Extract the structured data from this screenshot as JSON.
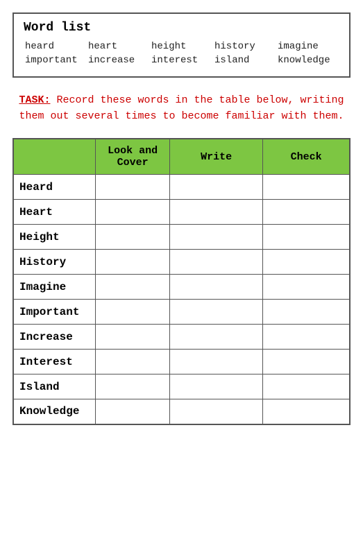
{
  "wordList": {
    "title": "Word list",
    "words": [
      [
        "heard",
        "heart",
        "height",
        "history",
        "imagine"
      ],
      [
        "important",
        "increase",
        "interest",
        "island",
        "knowledge"
      ]
    ]
  },
  "taskText": {
    "label": "TASK:",
    "body": " Record these words in the table below, writing them out several times to become familiar with them."
  },
  "table": {
    "headers": {
      "word": "",
      "lookAndCover": "Look and Cover",
      "write": "Write",
      "check": "Check"
    },
    "rows": [
      "Heard",
      "Heart",
      "Height",
      "History",
      "Imagine",
      "Important",
      "Increase",
      "Interest",
      "Island",
      "Knowledge"
    ]
  }
}
